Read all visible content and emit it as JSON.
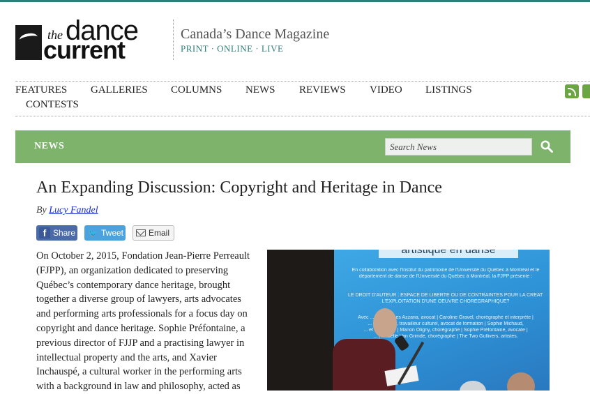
{
  "site": {
    "tagline": "Canada’s Dance Magazine",
    "sub_tagline": "PRINT · ONLINE · LIVE",
    "logo": {
      "the": "the",
      "dance": "dance",
      "current": "current"
    }
  },
  "nav": {
    "items": [
      "FEATURES",
      "GALLERIES",
      "COLUMNS",
      "NEWS",
      "REVIEWS",
      "VIDEO",
      "LISTINGS",
      "CONTESTS"
    ],
    "social_icons": [
      "rss-icon",
      "social-icon"
    ]
  },
  "section": {
    "title": "NEWS",
    "search_placeholder": "Search News",
    "search_icon": "search-icon"
  },
  "article": {
    "title": "An Expanding Discussion: Copyright and Heritage in Dance",
    "by_prefix": "By",
    "author": "Lucy Fandel",
    "share_buttons": {
      "share": "Share",
      "tweet": "Tweet",
      "email": "Email"
    },
    "body_lines": [
      "On October 2, 2015, Fondation Jean-Pierre Perreault",
      "(FJPP), an organization dedicated to preserving",
      "Québec’s contemporary dance heritage, brought",
      "together a diverse group of lawyers, arts advocates",
      "and performing arts professionals for a focus day on",
      "copyright and dance heritage. Sophie Préfontaine, a",
      "previous director of FJJP and a practising lawyer in",
      "intellectual property and the arts, and Xavier",
      "Inchauspé, a cultural worker in the performing arts",
      "with a background in law and philosophy, acted as"
    ],
    "photo": {
      "screen_heading": "artistique en danse",
      "screen_lines": [
        "En collaboration avec l'Institut du patrimoine de l'Université du Québec à Montréal et le",
        "département de danse de l'Université du Québec à Montréal, la FJPP présente :",
        "LE DROIT D'AUTEUR : ESPACE DE LIBERTÉ OU DE CONTRAINTES POUR LA CRÉATION ET",
        "L'EXPLOITATION D'UNE OEUVRE CHORÉGRAPHIQUE?",
        "Avec ... de Georges Azzaria, avocat | Caroline Gravel, chorégraphe et interprète |",
        "... philosophe, travailleur culturel, avocat de formation | Sophie Michaud,",
        "... et répétitrice | Manon Oligny, chorégraphe | Sophie Préfontaine, avocate |",
        "... | Isabelle Van Grimde, chorégraphe | The Two Gullivers, artistes."
      ]
    }
  }
}
